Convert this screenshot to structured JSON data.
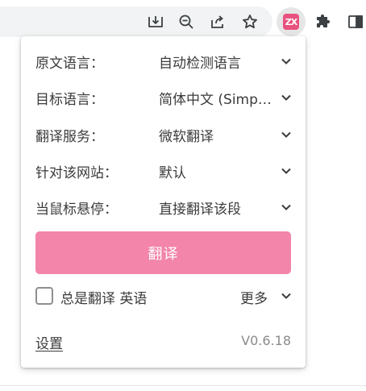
{
  "toolbar": {
    "icons": [
      "install-app-icon",
      "zoom-out-icon",
      "share-icon",
      "bookmark-star-icon",
      "extension-logo-icon",
      "puzzle-extensions-icon",
      "side-panel-icon"
    ],
    "extension_logo_text": "ZX"
  },
  "popup": {
    "rows": [
      {
        "label": "原文语言：",
        "value": "自动检测语言"
      },
      {
        "label": "目标语言：",
        "value": "简体中文 (Simplified Chinese)"
      },
      {
        "label": "翻译服务：",
        "value": "微软翻译"
      },
      {
        "label": "针对该网站：",
        "value": "默认"
      },
      {
        "label": "当鼠标悬停：",
        "value": "直接翻译该段"
      }
    ],
    "translate_button": "翻译",
    "always_translate": {
      "label": "总是翻译 英语",
      "checked": false
    },
    "more_label": "更多",
    "settings_label": "设置",
    "version": "V0.6.18"
  },
  "colors": {
    "accent": "#f285a9",
    "extension_logo": "#e8527f"
  }
}
